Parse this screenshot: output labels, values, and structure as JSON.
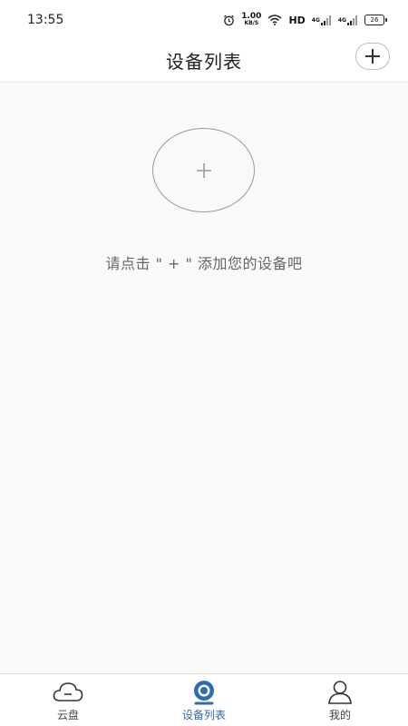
{
  "status_bar": {
    "time": "13:55",
    "speed_value": "1.00",
    "speed_unit": "KB/S",
    "hd_label": "HD",
    "signal1_label": "4G",
    "signal2_label": "4G",
    "battery_level": "26"
  },
  "header": {
    "title": "设备列表",
    "add_icon": "plus-icon"
  },
  "empty_state": {
    "plus_icon": "plus-icon",
    "message": "请点击 \" + \" 添加您的设备吧"
  },
  "tabbar": {
    "items": [
      {
        "label": "云盘",
        "icon": "cloud-icon",
        "active": false
      },
      {
        "label": "设备列表",
        "icon": "camera-icon",
        "active": true
      },
      {
        "label": "我的",
        "icon": "person-icon",
        "active": false
      }
    ]
  },
  "colors": {
    "accent": "#2f6db0",
    "background": "#f9f9f9",
    "text_secondary": "#666666"
  }
}
